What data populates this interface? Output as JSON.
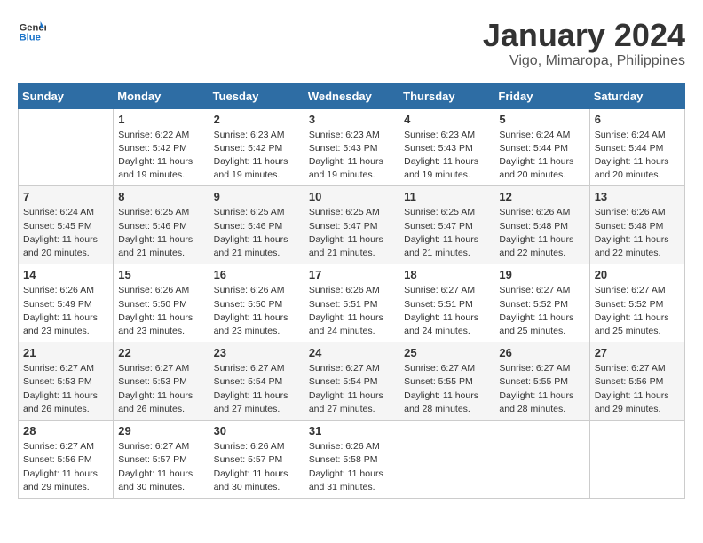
{
  "header": {
    "logo_line1": "General",
    "logo_line2": "Blue",
    "title": "January 2024",
    "subtitle": "Vigo, Mimaropa, Philippines"
  },
  "days_of_week": [
    "Sunday",
    "Monday",
    "Tuesday",
    "Wednesday",
    "Thursday",
    "Friday",
    "Saturday"
  ],
  "weeks": [
    [
      {
        "day": "",
        "info": ""
      },
      {
        "day": "1",
        "info": "Sunrise: 6:22 AM\nSunset: 5:42 PM\nDaylight: 11 hours\nand 19 minutes."
      },
      {
        "day": "2",
        "info": "Sunrise: 6:23 AM\nSunset: 5:42 PM\nDaylight: 11 hours\nand 19 minutes."
      },
      {
        "day": "3",
        "info": "Sunrise: 6:23 AM\nSunset: 5:43 PM\nDaylight: 11 hours\nand 19 minutes."
      },
      {
        "day": "4",
        "info": "Sunrise: 6:23 AM\nSunset: 5:43 PM\nDaylight: 11 hours\nand 19 minutes."
      },
      {
        "day": "5",
        "info": "Sunrise: 6:24 AM\nSunset: 5:44 PM\nDaylight: 11 hours\nand 20 minutes."
      },
      {
        "day": "6",
        "info": "Sunrise: 6:24 AM\nSunset: 5:44 PM\nDaylight: 11 hours\nand 20 minutes."
      }
    ],
    [
      {
        "day": "7",
        "info": "Sunrise: 6:24 AM\nSunset: 5:45 PM\nDaylight: 11 hours\nand 20 minutes."
      },
      {
        "day": "8",
        "info": "Sunrise: 6:25 AM\nSunset: 5:46 PM\nDaylight: 11 hours\nand 21 minutes."
      },
      {
        "day": "9",
        "info": "Sunrise: 6:25 AM\nSunset: 5:46 PM\nDaylight: 11 hours\nand 21 minutes."
      },
      {
        "day": "10",
        "info": "Sunrise: 6:25 AM\nSunset: 5:47 PM\nDaylight: 11 hours\nand 21 minutes."
      },
      {
        "day": "11",
        "info": "Sunrise: 6:25 AM\nSunset: 5:47 PM\nDaylight: 11 hours\nand 21 minutes."
      },
      {
        "day": "12",
        "info": "Sunrise: 6:26 AM\nSunset: 5:48 PM\nDaylight: 11 hours\nand 22 minutes."
      },
      {
        "day": "13",
        "info": "Sunrise: 6:26 AM\nSunset: 5:48 PM\nDaylight: 11 hours\nand 22 minutes."
      }
    ],
    [
      {
        "day": "14",
        "info": "Sunrise: 6:26 AM\nSunset: 5:49 PM\nDaylight: 11 hours\nand 23 minutes."
      },
      {
        "day": "15",
        "info": "Sunrise: 6:26 AM\nSunset: 5:50 PM\nDaylight: 11 hours\nand 23 minutes."
      },
      {
        "day": "16",
        "info": "Sunrise: 6:26 AM\nSunset: 5:50 PM\nDaylight: 11 hours\nand 23 minutes."
      },
      {
        "day": "17",
        "info": "Sunrise: 6:26 AM\nSunset: 5:51 PM\nDaylight: 11 hours\nand 24 minutes."
      },
      {
        "day": "18",
        "info": "Sunrise: 6:27 AM\nSunset: 5:51 PM\nDaylight: 11 hours\nand 24 minutes."
      },
      {
        "day": "19",
        "info": "Sunrise: 6:27 AM\nSunset: 5:52 PM\nDaylight: 11 hours\nand 25 minutes."
      },
      {
        "day": "20",
        "info": "Sunrise: 6:27 AM\nSunset: 5:52 PM\nDaylight: 11 hours\nand 25 minutes."
      }
    ],
    [
      {
        "day": "21",
        "info": "Sunrise: 6:27 AM\nSunset: 5:53 PM\nDaylight: 11 hours\nand 26 minutes."
      },
      {
        "day": "22",
        "info": "Sunrise: 6:27 AM\nSunset: 5:53 PM\nDaylight: 11 hours\nand 26 minutes."
      },
      {
        "day": "23",
        "info": "Sunrise: 6:27 AM\nSunset: 5:54 PM\nDaylight: 11 hours\nand 27 minutes."
      },
      {
        "day": "24",
        "info": "Sunrise: 6:27 AM\nSunset: 5:54 PM\nDaylight: 11 hours\nand 27 minutes."
      },
      {
        "day": "25",
        "info": "Sunrise: 6:27 AM\nSunset: 5:55 PM\nDaylight: 11 hours\nand 28 minutes."
      },
      {
        "day": "26",
        "info": "Sunrise: 6:27 AM\nSunset: 5:55 PM\nDaylight: 11 hours\nand 28 minutes."
      },
      {
        "day": "27",
        "info": "Sunrise: 6:27 AM\nSunset: 5:56 PM\nDaylight: 11 hours\nand 29 minutes."
      }
    ],
    [
      {
        "day": "28",
        "info": "Sunrise: 6:27 AM\nSunset: 5:56 PM\nDaylight: 11 hours\nand 29 minutes."
      },
      {
        "day": "29",
        "info": "Sunrise: 6:27 AM\nSunset: 5:57 PM\nDaylight: 11 hours\nand 30 minutes."
      },
      {
        "day": "30",
        "info": "Sunrise: 6:26 AM\nSunset: 5:57 PM\nDaylight: 11 hours\nand 30 minutes."
      },
      {
        "day": "31",
        "info": "Sunrise: 6:26 AM\nSunset: 5:58 PM\nDaylight: 11 hours\nand 31 minutes."
      },
      {
        "day": "",
        "info": ""
      },
      {
        "day": "",
        "info": ""
      },
      {
        "day": "",
        "info": ""
      }
    ]
  ]
}
